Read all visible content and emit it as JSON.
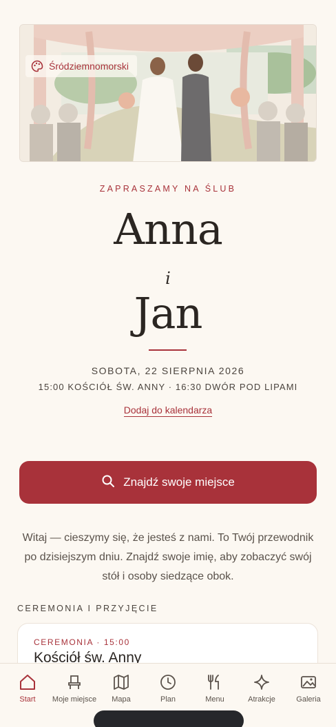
{
  "hero": {
    "theme_label": "Śródziemnomorski",
    "theme_icon": "palette-icon"
  },
  "invite": {
    "eyebrow": "ZAPRASZAMY NA ŚLUB",
    "name1": "Anna",
    "conjunction": "i",
    "name2": "Jan",
    "date": "SOBOTA, 22 SIERPNIA 2026",
    "places": "15:00 KOŚCIÓŁ ŚW. ANNY · 16:30 DWÓR POD LIPAMI",
    "calendar_link": "Dodaj do kalendarza"
  },
  "find_button": {
    "label": "Znajdź swoje miejsce",
    "icon": "search-icon"
  },
  "welcome_text": "Witaj — cieszymy się, że jesteś z nami. To Twój przewodnik po dzisiejszym dniu. Znajdź swoje imię, aby zobaczyć swój stół i osoby siedzące obok.",
  "section": {
    "title": "CEREMONIA I PRZYJĘCIE"
  },
  "ceremony_card": {
    "tag": "CEREMONIA · 15:00",
    "title": "Kościół św. Anny"
  },
  "tabs": [
    {
      "label": "Start",
      "icon": "home-icon",
      "active": true
    },
    {
      "label": "Moje miejsce",
      "icon": "seat-icon",
      "active": false
    },
    {
      "label": "Mapa",
      "icon": "map-icon",
      "active": false
    },
    {
      "label": "Plan",
      "icon": "clock-icon",
      "active": false
    },
    {
      "label": "Menu",
      "icon": "cutlery-icon",
      "active": false
    },
    {
      "label": "Atrakcje",
      "icon": "sparkle-icon",
      "active": false
    },
    {
      "label": "Galeria",
      "icon": "image-icon",
      "active": false
    }
  ],
  "colors": {
    "accent": "#a8323a",
    "background": "#fcf8f2",
    "text": "#2b2622"
  }
}
